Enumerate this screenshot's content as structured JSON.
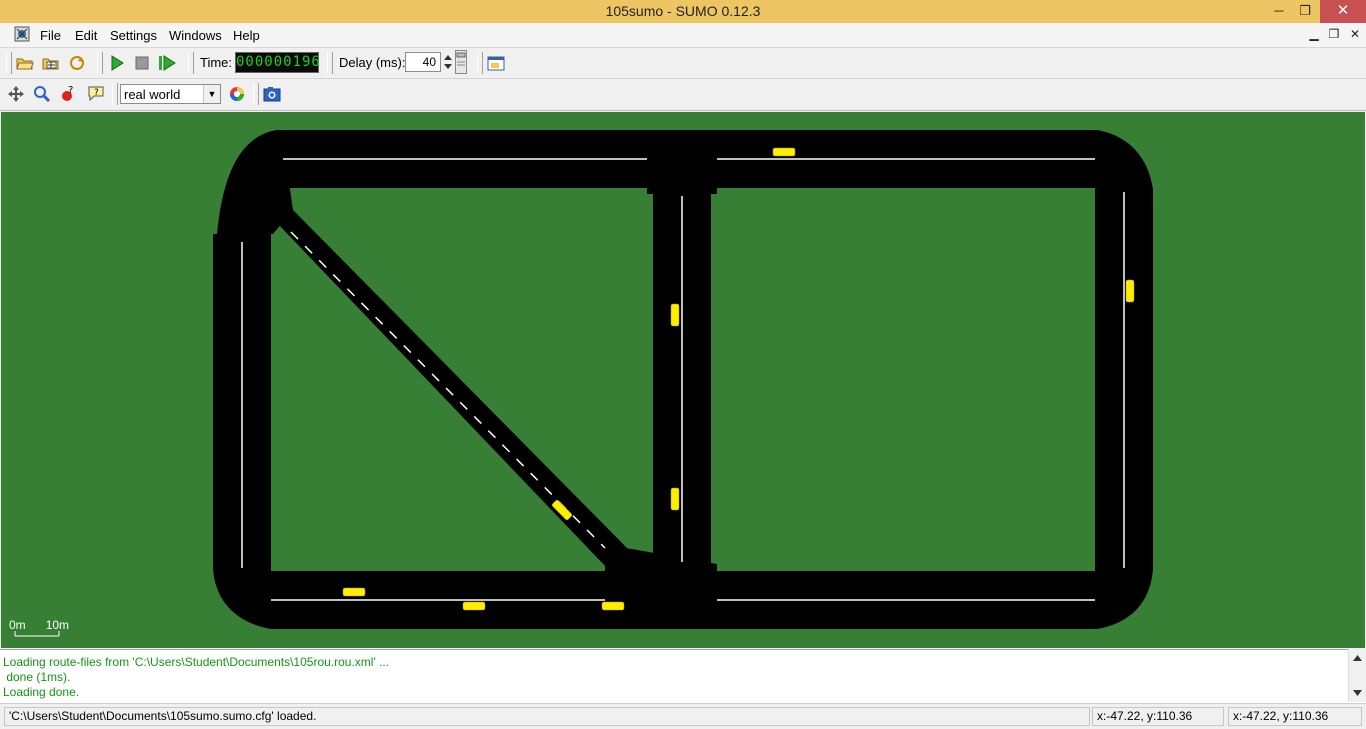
{
  "window": {
    "title": "105sumo - SUMO 0.12.3",
    "controls": {
      "minimize": "─",
      "maximize": "❐",
      "close": "✕"
    }
  },
  "menu": {
    "file": "File",
    "edit": "Edit",
    "settings": "Settings",
    "windows": "Windows",
    "help": "Help",
    "mdi_controls": {
      "minimize": "▁",
      "restore": "❐",
      "close": "✕"
    }
  },
  "toolbar": {
    "time_label": "Time:",
    "time_value": "000000196",
    "delay_label": "Delay (ms):",
    "delay_value": "40",
    "icons": [
      "open-simulation-icon",
      "open-network-icon",
      "reload-icon",
      "run-icon",
      "stop-icon",
      "step-icon",
      "new-view-icon"
    ]
  },
  "view_toolbar": {
    "scheme_options": [
      "real world"
    ],
    "scheme_selected": "real world",
    "icons": [
      "recenter-view-icon",
      "locate-icon",
      "breakpoint-icon",
      "tooltip-icon",
      "color-scheme-icon",
      "screenshot-icon"
    ]
  },
  "canvas": {
    "background_color": "#367f35",
    "road_color": "#000000",
    "vehicle_color": "#ffee00",
    "scale_bar": {
      "start": "0m",
      "end": "10m"
    }
  },
  "messages": [
    "Loading route-files from 'C:\\Users\\Student\\Documents\\105rou.rou.xml' ...",
    " done (1ms).",
    "Loading done."
  ],
  "status": {
    "main": "'C:\\Users\\Student\\Documents\\105sumo.sumo.cfg' loaded.",
    "coords1": "x:-47.22, y:110.36",
    "coords2": "x:-47.22, y:110.36"
  }
}
